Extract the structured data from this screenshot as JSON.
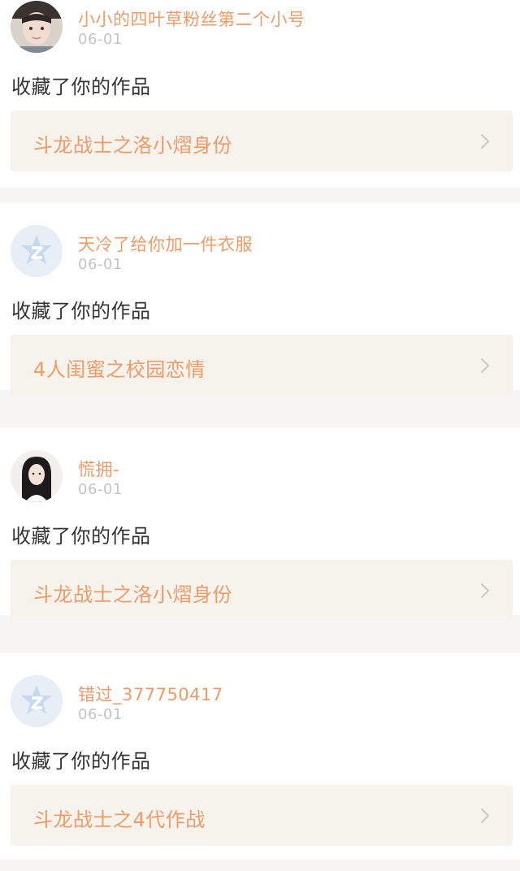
{
  "notifications": [
    {
      "username": "小小的四叶草粉丝第二个小号",
      "time": "06-01",
      "action": "收藏了你的作品",
      "work_title": "斗龙战士之洛小熠身份",
      "avatar_icon": "user-photo-icon"
    },
    {
      "username": "天冷了给你加一件衣服",
      "time": "06-01",
      "action": "收藏了你的作品",
      "work_title": "4人闺蜜之校园恋情",
      "avatar_icon": "default-avatar-icon"
    },
    {
      "username": "慌拥-",
      "time": "06-01",
      "action": "收藏了你的作品",
      "work_title": "斗龙战士之洛小熠身份",
      "avatar_icon": "user-photo-icon"
    },
    {
      "username": "错过_377750417",
      "time": "06-01",
      "action": "收藏了你的作品",
      "work_title": "斗龙战士之4代作战",
      "avatar_icon": "default-avatar-icon"
    }
  ],
  "colors": {
    "accent": "#ee9b6a",
    "time": "#c4c4c4",
    "link_bg": "#f5f3ec",
    "separator": "#f7f4f4"
  }
}
